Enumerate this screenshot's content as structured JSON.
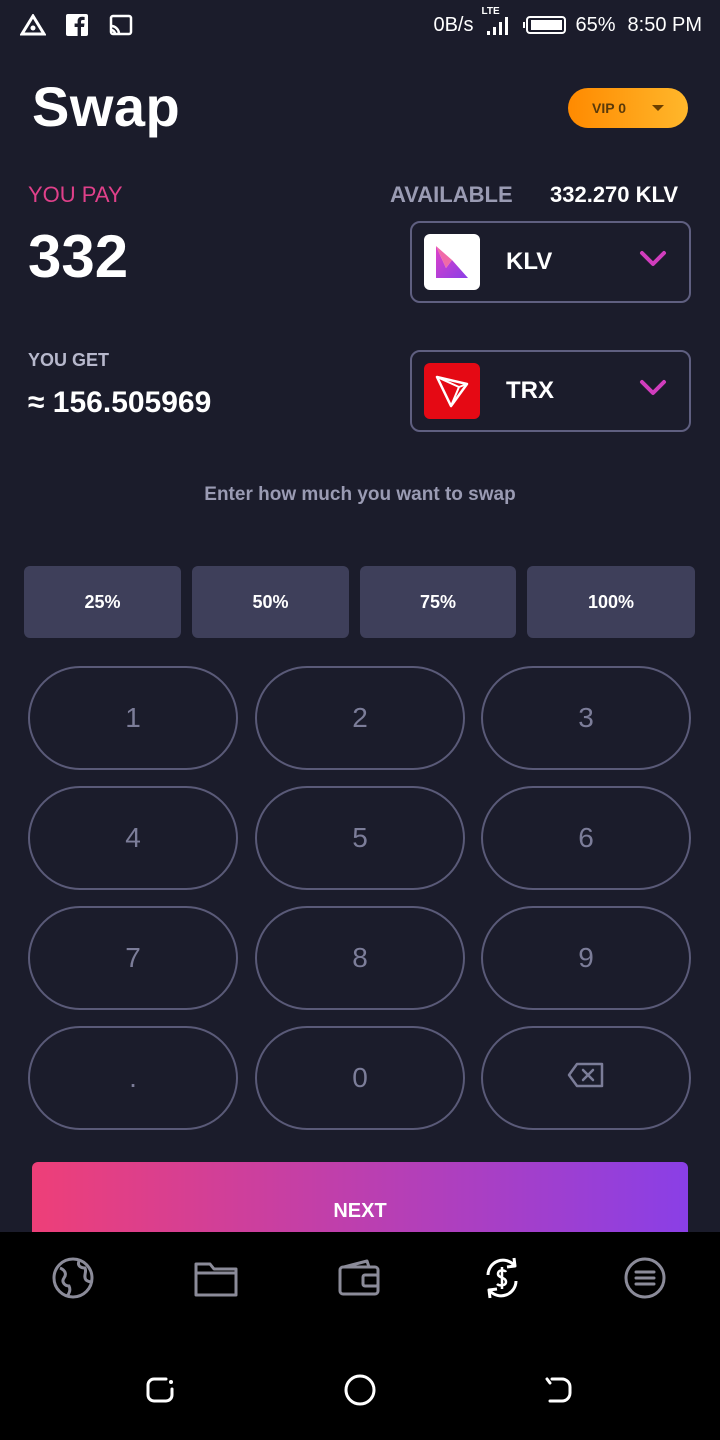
{
  "status_bar": {
    "net_speed": "0B/s",
    "network_type": "LTE",
    "battery": "65%",
    "time": "8:50 PM"
  },
  "header": {
    "title": "Swap",
    "vip_label": "VIP 0"
  },
  "pay": {
    "label": "YOU PAY",
    "amount": "332",
    "available_label": "AVAILABLE",
    "available_value": "332.270 KLV",
    "token": "KLV"
  },
  "get": {
    "label": "YOU GET",
    "amount": "≈ 156.505969",
    "token": "TRX"
  },
  "hint": "Enter how much you want to swap",
  "percent_buttons": [
    "25%",
    "50%",
    "75%",
    "100%"
  ],
  "keypad": [
    "1",
    "2",
    "3",
    "4",
    "5",
    "6",
    "7",
    "8",
    "9",
    ".",
    "0"
  ],
  "next_label": "NEXT",
  "colors": {
    "background": "#1b1c2b",
    "accent_pink": "#e0408a",
    "vip_orange": "#ff8a00",
    "button_gray": "#3e3f5a",
    "trx_red": "#e50914"
  }
}
